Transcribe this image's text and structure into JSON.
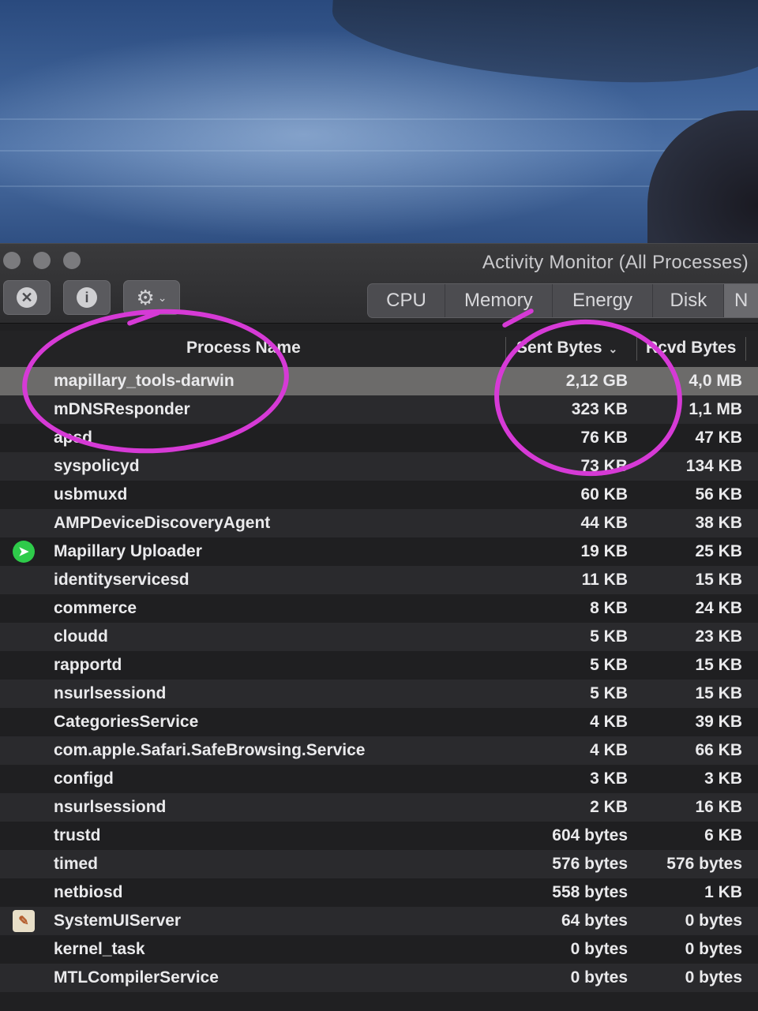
{
  "window": {
    "title": "Activity Monitor (All Processes)"
  },
  "toolbar": {
    "stop_icon": "x-circle-icon",
    "info_icon": "info-icon",
    "gear_icon": "gear-icon"
  },
  "tabs": [
    {
      "label": "CPU",
      "active": false
    },
    {
      "label": "Memory",
      "active": false
    },
    {
      "label": "Energy",
      "active": false
    },
    {
      "label": "Disk",
      "active": false
    },
    {
      "label": "N",
      "active": true
    }
  ],
  "table": {
    "columns": {
      "process_name": "Process Name",
      "sent_bytes": "Sent Bytes",
      "rcvd_bytes": "Rcvd Bytes"
    },
    "sort_column": "sent_bytes",
    "rows": [
      {
        "name": "mapillary_tools-darwin",
        "sent": "2,12 GB",
        "rcvd": "4,0 MB",
        "selected": true,
        "icon": ""
      },
      {
        "name": "mDNSResponder",
        "sent": "323 KB",
        "rcvd": "1,1 MB",
        "icon": ""
      },
      {
        "name": "apsd",
        "sent": "76 KB",
        "rcvd": "47 KB",
        "icon": ""
      },
      {
        "name": "syspolicyd",
        "sent": "73 KB",
        "rcvd": "134 KB",
        "icon": ""
      },
      {
        "name": "usbmuxd",
        "sent": "60 KB",
        "rcvd": "56 KB",
        "icon": ""
      },
      {
        "name": "AMPDeviceDiscoveryAgent",
        "sent": "44 KB",
        "rcvd": "38 KB",
        "icon": ""
      },
      {
        "name": "Mapillary Uploader",
        "sent": "19 KB",
        "rcvd": "25 KB",
        "icon": "mapillary-app-icon"
      },
      {
        "name": "identityservicesd",
        "sent": "11 KB",
        "rcvd": "15 KB",
        "icon": ""
      },
      {
        "name": "commerce",
        "sent": "8 KB",
        "rcvd": "24 KB",
        "icon": ""
      },
      {
        "name": "cloudd",
        "sent": "5 KB",
        "rcvd": "23 KB",
        "icon": ""
      },
      {
        "name": "rapportd",
        "sent": "5 KB",
        "rcvd": "15 KB",
        "icon": ""
      },
      {
        "name": "nsurlsessiond",
        "sent": "5 KB",
        "rcvd": "15 KB",
        "icon": ""
      },
      {
        "name": "CategoriesService",
        "sent": "4 KB",
        "rcvd": "39 KB",
        "icon": ""
      },
      {
        "name": "com.apple.Safari.SafeBrowsing.Service",
        "sent": "4 KB",
        "rcvd": "66 KB",
        "icon": ""
      },
      {
        "name": "configd",
        "sent": "3 KB",
        "rcvd": "3 KB",
        "icon": ""
      },
      {
        "name": "nsurlsessiond",
        "sent": "2 KB",
        "rcvd": "16 KB",
        "icon": ""
      },
      {
        "name": "trustd",
        "sent": "604 bytes",
        "rcvd": "6 KB",
        "icon": ""
      },
      {
        "name": "timed",
        "sent": "576 bytes",
        "rcvd": "576 bytes",
        "icon": ""
      },
      {
        "name": "netbiosd",
        "sent": "558 bytes",
        "rcvd": "1 KB",
        "icon": ""
      },
      {
        "name": "SystemUIServer",
        "sent": "64 bytes",
        "rcvd": "0 bytes",
        "icon": "systemuiserver-icon"
      },
      {
        "name": "kernel_task",
        "sent": "0 bytes",
        "rcvd": "0 bytes",
        "icon": ""
      },
      {
        "name": "MTLCompilerService",
        "sent": "0 bytes",
        "rcvd": "0 bytes",
        "icon": ""
      }
    ]
  },
  "annotations": {
    "color": "#d63ad6"
  }
}
